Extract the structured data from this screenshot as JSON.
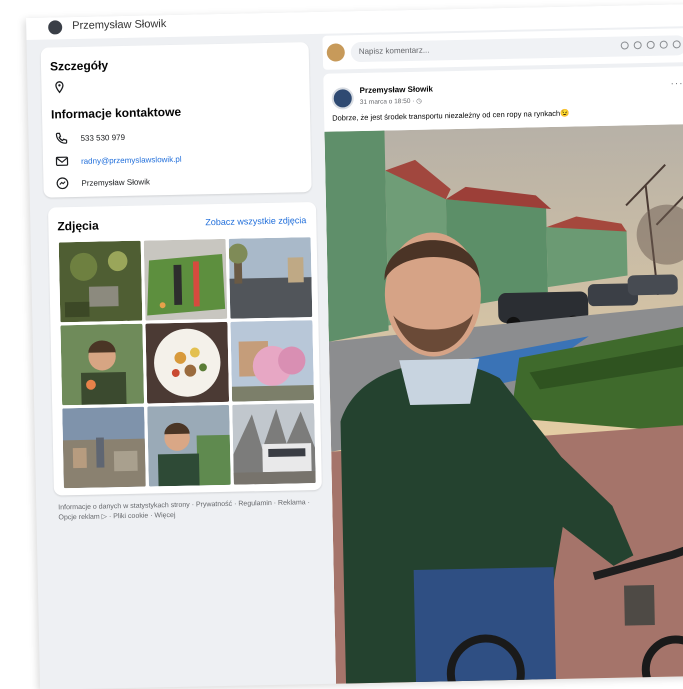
{
  "header": {
    "profile_name": "Przemysław Słowik"
  },
  "details": {
    "title": "Szczegóły",
    "contact_title": "Informacje kontaktowe",
    "phone": "533 530 979",
    "email": "radny@przemyslawslowik.pl",
    "messenger": "Przemysław Słowik"
  },
  "photos": {
    "title": "Zdjęcia",
    "see_all": "Zobacz wszystkie zdjęcia",
    "items": [
      {
        "label": "ogród z kotem"
      },
      {
        "label": "makieta parku"
      },
      {
        "label": "plac i drzewa"
      },
      {
        "label": "selfie w parku"
      },
      {
        "label": "talerz z jedzeniem"
      },
      {
        "label": "kwitnące drzewo"
      },
      {
        "label": "panorama miasta"
      },
      {
        "label": "selfie przy fontannie"
      },
      {
        "label": "tramwaj"
      }
    ]
  },
  "footer": {
    "links": "Informacje o danych w statystykach strony · Prywatność · Regulamin · Reklama · Opcje reklam ▷ · Pliki cookie · Więcej"
  },
  "comment": {
    "placeholder": "Napisz komentarz..."
  },
  "post": {
    "author": "Przemysław Słowik",
    "date": "31 marca o 18:50 · ◷",
    "more": "···",
    "text": "Dobrze, że jest środek transportu niezależny od cen ropy na rynkach😉",
    "photo_alt": "Mężczyzna na rowerze przed zielonymi kamienicami"
  },
  "colors": {
    "link": "#216fdb",
    "page_bg": "#eef0f3"
  }
}
